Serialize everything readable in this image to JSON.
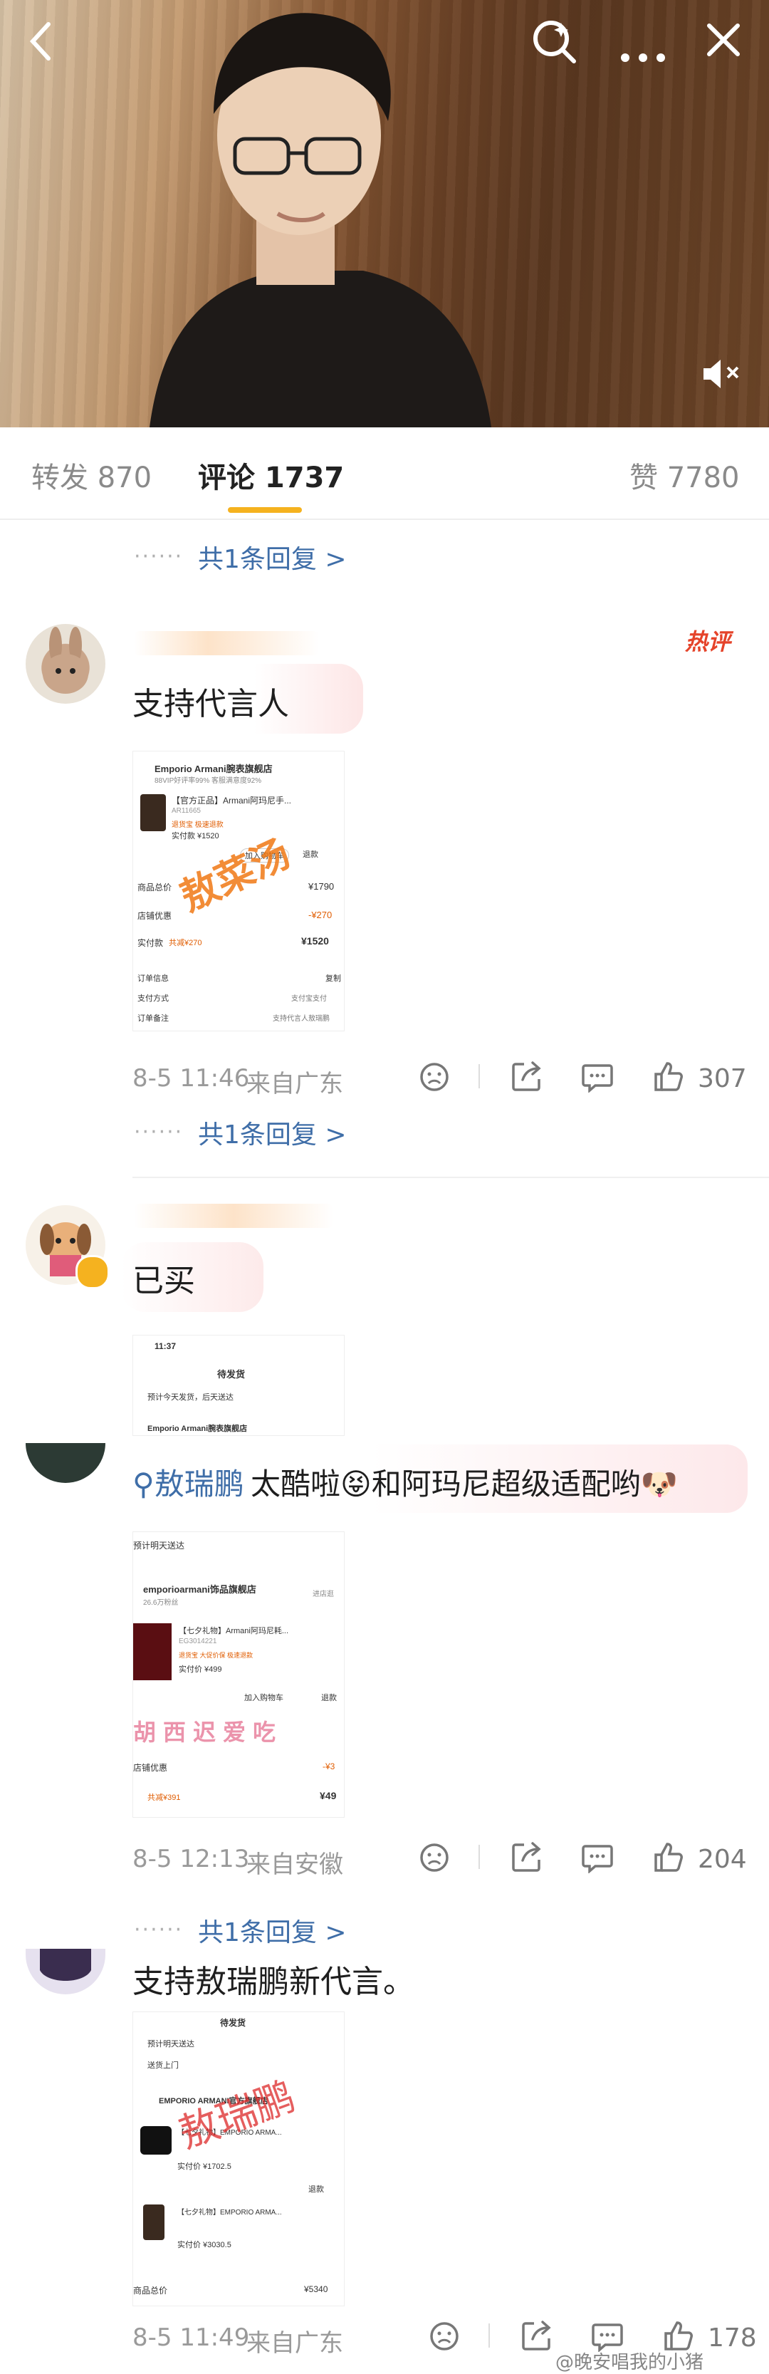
{
  "header": {
    "back_icon": "back-arrow-icon",
    "search_icon": "search-sparkle-icon",
    "more_icon": "more-dots-icon",
    "close_icon": "close-icon",
    "mute_icon": "mute-speaker-icon"
  },
  "tabs": {
    "repost": "转发 870",
    "comments": "评论 1737",
    "likes": "赞 7780"
  },
  "colors": {
    "accent": "#f5b21f",
    "link": "#3f6ea8",
    "hot": "#e5432a"
  },
  "reply_link_label": "共1条回复 >",
  "comments": [
    {
      "text": "支持代言人",
      "hot_badge": "热评",
      "time": "8-5 11:46",
      "location": "来自广东",
      "likes": "307",
      "shot": {
        "store": "Emporio Armani腕表旗舰店",
        "store_sub": "88VIP好评率99%  客服满意度92%",
        "product": "【官方正品】Armani阿玛尼手...",
        "sku": "AR11665",
        "badges": "退货宝  极速退款",
        "paid": "实付款 ¥1520",
        "add_cart": "加入购物车",
        "refund": "退款",
        "total_label": "商品总价",
        "total": "¥1790",
        "discount_label": "店铺优惠",
        "discount": "-¥270",
        "paid_label": "实付款",
        "saved": "共减¥270",
        "paid_total": "¥1520",
        "order_info": "订单信息",
        "pay_method": "支付方式",
        "pay_value": "支付宝支付",
        "remark": "订单备注",
        "remark_value": "支持代言人敖瑞鹏",
        "copy": "复制",
        "watermark": "敖菜汤"
      }
    },
    {
      "text": "已买",
      "shot": {
        "time": "11:37",
        "title": "待发货",
        "notice": "预计今天发货，后天送达",
        "store": "Emporio Armani腕表旗舰店"
      }
    },
    {
      "text": "敖瑞鹏 太酷啦和阿玛尼超级适配哟",
      "mention": "敖瑞鹏",
      "rest": " 太酷啦😝和阿玛尼超级适配哟🐶",
      "time": "8-5 12:13",
      "location": "来自安徽",
      "likes": "204",
      "shot": {
        "notice": "预计明天送达",
        "store": "emporioarmani饰品旗舰店",
        "store_sub": "26.6万粉丝",
        "enter": "进店逛",
        "product": "【七夕礼物】Armani阿玛尼耗...",
        "sku": "EG3014221",
        "badges": "退货宝  大促价保  极速退款",
        "paid": "实付价 ¥499",
        "add_cart": "加入购物车",
        "refund": "退款",
        "discount_label": "店铺优惠",
        "discount": "-¥3",
        "saved": "共减¥391",
        "paid_total": "¥49",
        "overlay": "胡西迟爱吃"
      }
    },
    {
      "text": "支持敖瑞鹏新代言。",
      "time": "8-5 11:49",
      "location": "来自广东",
      "likes": "178",
      "shot": {
        "title": "待发货",
        "notice": "预计明天送达",
        "pickup": "送货上门",
        "store": "EMPORIO ARMANI官方旗舰店",
        "product1": "【七夕礼物】EMPORIO ARMA...",
        "paid1": "实付价 ¥1702.5",
        "product2": "【七夕礼物】EMPORIO ARMA...",
        "paid2": "实付价 ¥3030.5",
        "refund": "退款",
        "total_label": "商品总价",
        "total": "¥5340",
        "scribble": "敖瑞鹏"
      }
    }
  ],
  "weibo_watermark": "@晚安唱我的小猪"
}
